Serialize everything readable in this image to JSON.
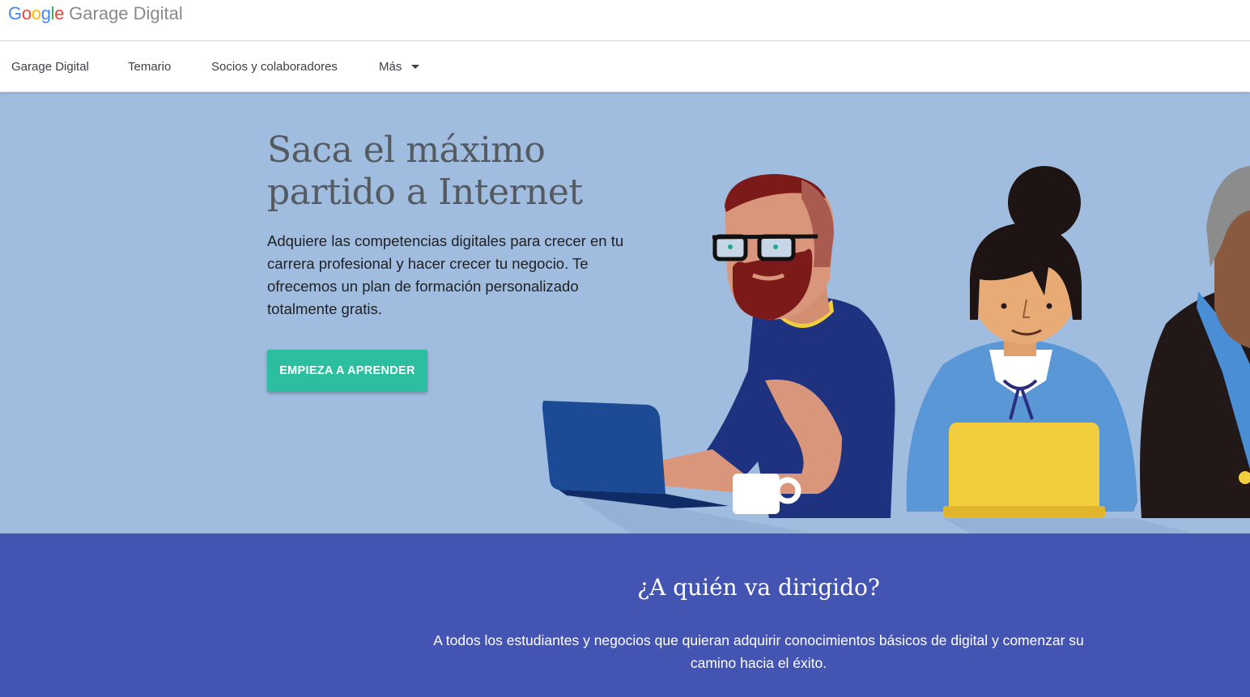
{
  "brand": {
    "google_letters": [
      {
        "char": "G",
        "color": "#4285F4"
      },
      {
        "char": "o",
        "color": "#EA4335"
      },
      {
        "char": "o",
        "color": "#FBBC05"
      },
      {
        "char": "g",
        "color": "#4285F4"
      },
      {
        "char": "l",
        "color": "#34A853"
      },
      {
        "char": "e",
        "color": "#EA4335"
      }
    ],
    "product": "Garage Digital"
  },
  "nav": {
    "items": [
      "Garage Digital",
      "Temario",
      "Socios y colaboradores",
      "Más"
    ],
    "more_icon": "dropdown-caret"
  },
  "hero": {
    "title_line1": "Saca el máximo",
    "title_line2": "partido a Internet",
    "description": "Adquiere las competencias digitales para crecer en tu carrera profesional y hacer crecer tu negocio. Te ofrecemos un plan de formación personalizado totalmente gratis.",
    "cta_label": "EMPIEZA A APRENDER",
    "background_color": "#a0bde0",
    "cta_color": "#2bbfa0"
  },
  "audience": {
    "title": "¿A quién va dirigido?",
    "description": "A todos los estudiantes y negocios que quieran adquirir conocimientos básicos de digital y comenzar su camino hacia el éxito.",
    "background_color": "#4354b3"
  }
}
